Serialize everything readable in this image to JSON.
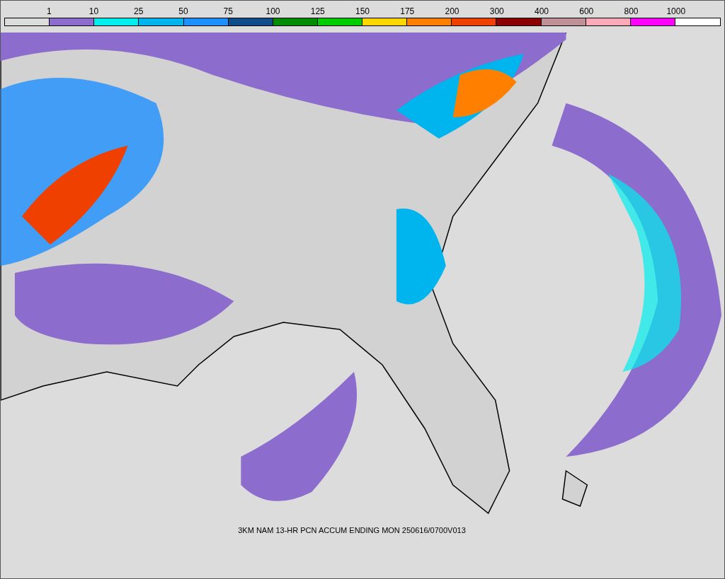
{
  "legend": {
    "labels": [
      "1",
      "10",
      "25",
      "50",
      "75",
      "100",
      "125",
      "150",
      "175",
      "200",
      "300",
      "400",
      "600",
      "800",
      "1000"
    ],
    "bins": [
      {
        "color": "#dcdcdc"
      },
      {
        "color": "#8c6ccc"
      },
      {
        "color": "#00eeee"
      },
      {
        "color": "#00b4ee"
      },
      {
        "color": "#1e90ff"
      },
      {
        "color": "#104e8b"
      },
      {
        "color": "#008b00"
      },
      {
        "color": "#00cd00"
      },
      {
        "color": "#ffd700"
      },
      {
        "color": "#ff8000"
      },
      {
        "color": "#f04000"
      },
      {
        "color": "#8b0000"
      },
      {
        "color": "#c09098"
      },
      {
        "color": "#ffaab8"
      },
      {
        "color": "#ff00ff"
      },
      {
        "color": "#ffffff"
      }
    ]
  },
  "caption": "3KM NAM 13-HR PCN ACCUM ENDING MON 250616/0700V013"
}
